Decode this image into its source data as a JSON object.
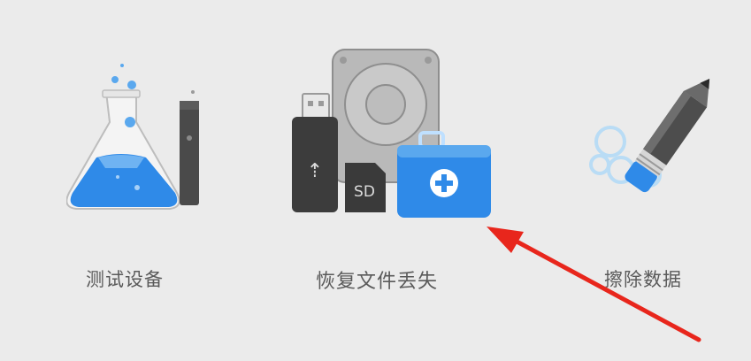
{
  "tiles": [
    {
      "label": "测试设备",
      "icon": "flask-icon"
    },
    {
      "label": "恢复文件丢失",
      "icon": "recover-files-icon"
    },
    {
      "label": "擦除数据",
      "icon": "erase-pen-icon"
    }
  ],
  "colors": {
    "background": "#ebebeb",
    "accent_blue": "#2f8ae8",
    "label_gray": "#5a5a5a",
    "arrow_red": "#e8261c"
  }
}
